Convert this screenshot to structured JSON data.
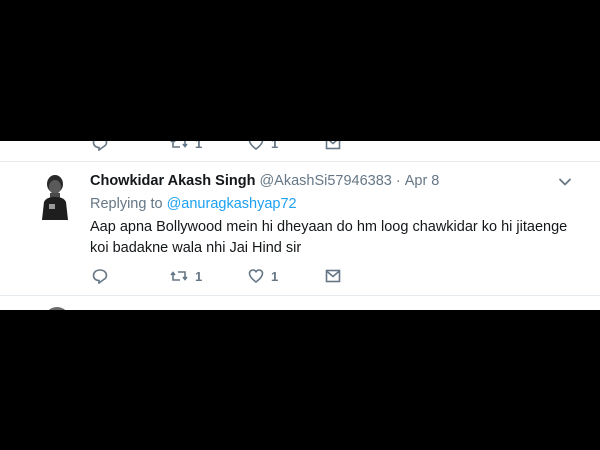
{
  "previous_tweet": {
    "actions": {
      "retweet_count": "1",
      "like_count": "1"
    }
  },
  "tweet": {
    "display_name": "Chowkidar Akash Singh",
    "handle": "@AkashSi57946383",
    "separator": "·",
    "time": "Apr 8",
    "replying_prefix": "Replying to ",
    "replying_to": "@anuragkashyap72",
    "text": "Aap apna Bollywood mein hi dheyaan do hm loog chawkidar ko hi jitaenge koi badakne wala nhi Jai Hind sir",
    "actions": {
      "reply_icon": "reply-icon",
      "retweet_icon": "retweet-icon",
      "retweet_count": "1",
      "like_icon": "heart-icon",
      "like_count": "1",
      "dm_icon": "envelope-icon"
    }
  },
  "colors": {
    "background": "#000000",
    "card": "#ffffff",
    "text": "#14171a",
    "muted": "#657786",
    "link": "#1da1f2",
    "divider": "#e6ecf0"
  }
}
